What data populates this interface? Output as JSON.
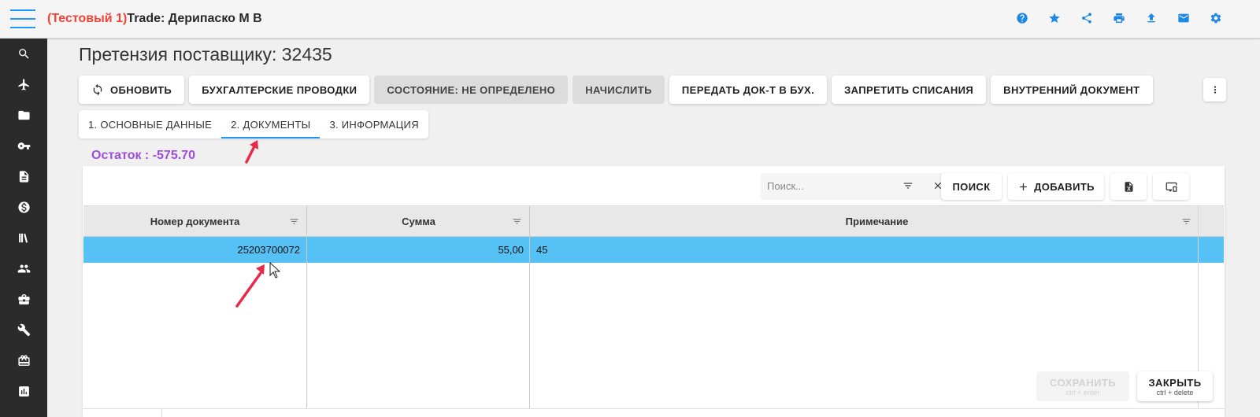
{
  "header": {
    "test_label": "(Тестовый 1)",
    "title": "Trade: Дерипаско М В",
    "icons": [
      "help-icon",
      "star-icon",
      "share-icon",
      "print-icon",
      "upload-icon",
      "mail-icon",
      "settings-icon"
    ]
  },
  "sidebar": {
    "items": [
      "search-icon",
      "plane-icon",
      "folder-icon",
      "key-icon",
      "document-icon",
      "dollar-icon",
      "library-icon",
      "people-icon",
      "briefcase-icon",
      "wrench-icon",
      "gift-icon",
      "chart-icon"
    ]
  },
  "page": {
    "title": "Претензия поставщику: 32435"
  },
  "toolbar": {
    "refresh": "ОБНОВИТЬ",
    "accounting": "БУХГАЛТЕРСКИЕ ПРОВОДКИ",
    "state": "СОСТОЯНИЕ: НЕ ОПРЕДЕЛЕНО",
    "charge": "НАЧИСЛИТЬ",
    "transfer": "ПЕРЕДАТЬ ДОК-Т В БУХ.",
    "forbid": "ЗАПРЕТИТЬ СПИСАНИЯ",
    "internal": "ВНУТРЕННИЙ ДОКУМЕНТ"
  },
  "tabs": [
    {
      "label": "1. ОСНОВНЫЕ ДАННЫЕ",
      "active": false
    },
    {
      "label": "2. ДОКУМЕНТЫ",
      "active": true
    },
    {
      "label": "3. ИНФОРМАЦИЯ",
      "active": false
    }
  ],
  "remainder": "Остаток : -575.70",
  "panel": {
    "search_placeholder": "Поиск...",
    "search_button": "ПОИСК",
    "add_button": "ДОБАВИТЬ"
  },
  "table": {
    "columns": [
      "Номер документа",
      "Сумма",
      "Примечание"
    ],
    "rows": [
      {
        "doc_number": "25203700072",
        "sum": "55,00",
        "note": "45",
        "selected": true
      }
    ]
  },
  "actions": {
    "save": "СОХРАНИТЬ",
    "save_hint": "ctrl + enter",
    "close": "ЗАКРЫТЬ",
    "close_hint": "ctrl + delete"
  },
  "colors": {
    "accent": "#2196f3",
    "selected_row": "#56c1f5",
    "remainder": "#9c4dde",
    "test_label": "#f44336",
    "sidebar_bg": "#2b2b2b",
    "arrow": "#e8294a"
  }
}
